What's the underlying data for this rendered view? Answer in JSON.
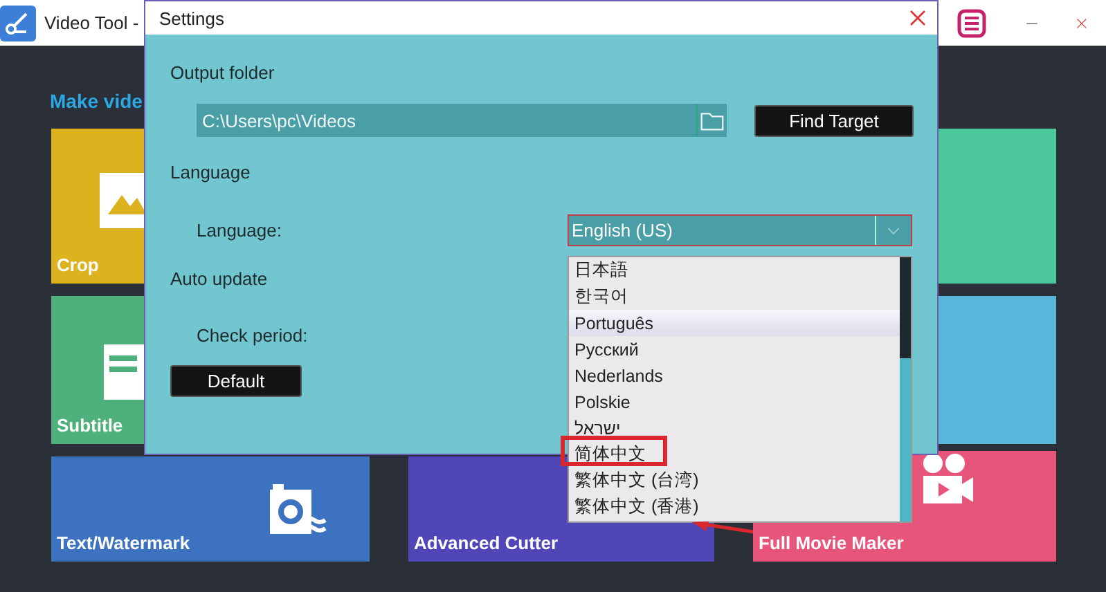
{
  "app": {
    "title": "Video Tool -",
    "heading": "Make vide",
    "tiles": [
      {
        "label": "Crop",
        "kind": "crop",
        "color": "#dcb21e"
      },
      {
        "kind": "audio",
        "color": "#4bc79b"
      },
      {
        "label": "Subtitle",
        "kind": "subtitle",
        "color": "#4eb07a"
      },
      {
        "kind": "clip",
        "color": "#57b6d9"
      },
      {
        "label": "Text/Watermark",
        "kind": "watermark",
        "color": "#3d72c0"
      },
      {
        "label": "Advanced Cutter",
        "kind": "cutter",
        "color": "#5146b8"
      },
      {
        "label": "Full Movie Maker",
        "kind": "movie",
        "color": "#e8557a"
      }
    ]
  },
  "dialog": {
    "title": "Settings",
    "output_folder": {
      "heading": "Output folder",
      "value": "C:\\Users\\pc\\Videos",
      "button": "Find Target"
    },
    "language": {
      "heading": "Language",
      "label": "Language:",
      "value": "English (US)",
      "options": [
        {
          "label": "日本語",
          "selected": false
        },
        {
          "label": "한국어",
          "selected": false
        },
        {
          "label": "Português",
          "selected": true
        },
        {
          "label": "Русский",
          "selected": false
        },
        {
          "label": "Nederlands",
          "selected": false
        },
        {
          "label": "Polskie",
          "selected": false
        },
        {
          "label": "ישראל",
          "selected": false
        },
        {
          "label": "简体中文",
          "selected": false
        },
        {
          "label": "繁体中文 (台湾)",
          "selected": false
        },
        {
          "label": "繁体中文 (香港)",
          "selected": false
        }
      ]
    },
    "auto_update": {
      "heading": "Auto update",
      "label": "Check period:"
    },
    "default_button": "Default"
  }
}
